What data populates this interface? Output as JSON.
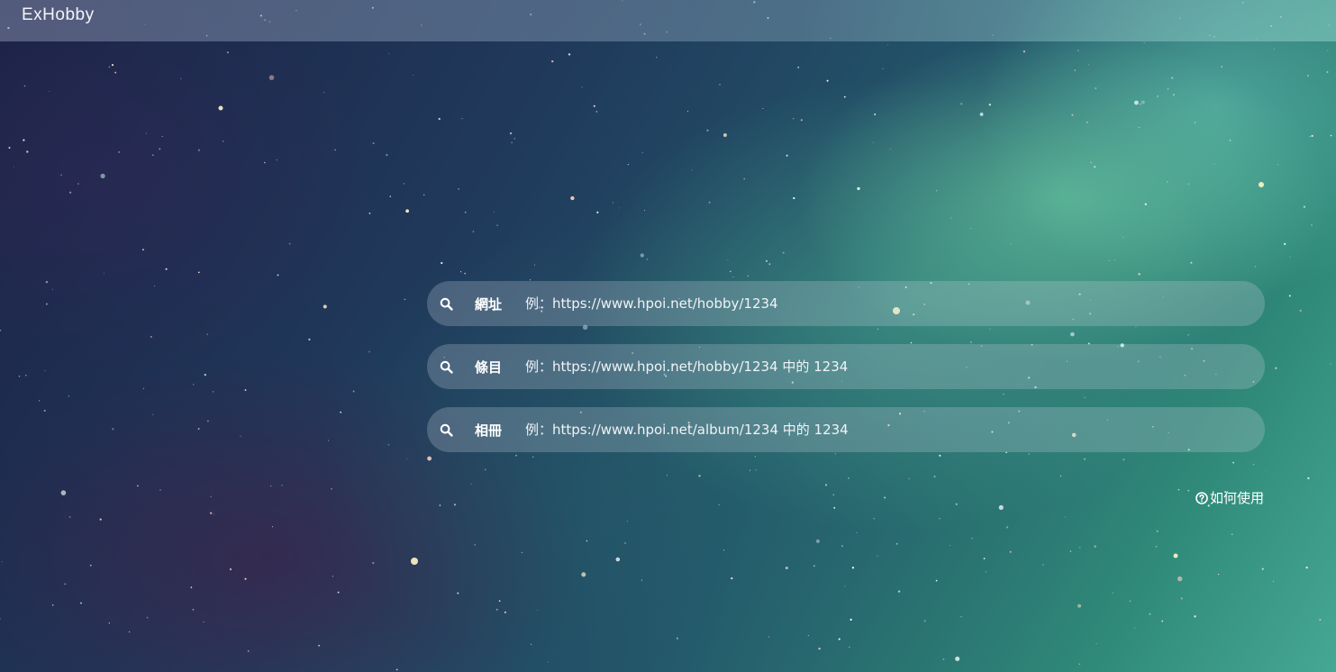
{
  "app": {
    "brand": "ExHobby"
  },
  "search": [
    {
      "label": "網址",
      "placeholder": "例：https://www.hpoi.net/hobby/1234",
      "icon": "search-icon"
    },
    {
      "label": "條目",
      "placeholder": "例：https://www.hpoi.net/hobby/1234 中的 1234",
      "icon": "search-icon"
    },
    {
      "label": "相冊",
      "placeholder": "例：https://www.hpoi.net/album/1234 中的 1234",
      "icon": "search-icon"
    }
  ],
  "help": {
    "label": "如何使用",
    "icon": "question-circle-icon"
  },
  "colors": {
    "navbar": "#8f9fb8",
    "field_bg": "#c8d2dc",
    "text": "#ffffff",
    "nebula_green": "#5fc9a0",
    "space_dark": "#1c2246"
  }
}
